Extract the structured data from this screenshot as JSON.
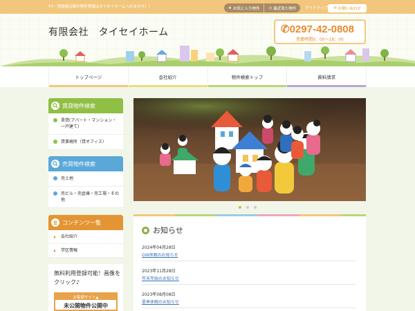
{
  "header": {
    "tagline": "TX・常総線沿線の物件情報はタイセイホームへおまかせ！！",
    "favorites_label": "お気に入り物件",
    "recent_label": "最近見た物件",
    "sitemap_label": "サイトマップ",
    "contact_label": "お問い合わせ",
    "company_name": "有限会社　タイセイホーム",
    "phone": "0297-42-0808",
    "hours": "営業時間9：00～18：00"
  },
  "nav": {
    "items": [
      {
        "label": "トップページ",
        "color": "#f2c77d"
      },
      {
        "label": "会社紹介",
        "color": "#e6e07a"
      },
      {
        "label": "物件検索トップ",
        "color": "#b8d67a"
      },
      {
        "label": "資料請求",
        "color": "#b6a4d6"
      }
    ]
  },
  "sidebar": {
    "rental": {
      "title": "賃貸物件検索",
      "color": "#8fbf45",
      "items": [
        "賃貸(アパート・マンション・一戸建て)",
        "貸事務所（貸オフィス）"
      ]
    },
    "sale": {
      "title": "売買物件検索",
      "color": "#5aa8d8",
      "items": [
        "売土地",
        "売ビル・売倉庫・売工場・その他"
      ]
    },
    "contents": {
      "title": "コンテンツ一覧",
      "color": "#e39533",
      "items": [
        "会社紹介",
        "学区情報"
      ]
    },
    "register": {
      "text": "無料利用登録可能！画像をクリック♪",
      "banner_top": "お客様サイト▲",
      "banner_main": "未公開物件公開中"
    }
  },
  "news": {
    "title": "お知らせ",
    "items": [
      {
        "date": "2024年04月28日",
        "title": "GW休暇のお知らせ"
      },
      {
        "date": "2023年11月28日",
        "title": "年末年始のお知らせ"
      },
      {
        "date": "2023年08月08日",
        "title": "夏季休暇のお知らせ"
      }
    ]
  },
  "slider": {
    "slide_count": 3,
    "active_index": 0
  },
  "colors": {
    "accent_orange": "#e88c2c",
    "rental_green": "#8fbf45",
    "sale_blue": "#5aa8d8",
    "content_orange": "#e39533"
  }
}
